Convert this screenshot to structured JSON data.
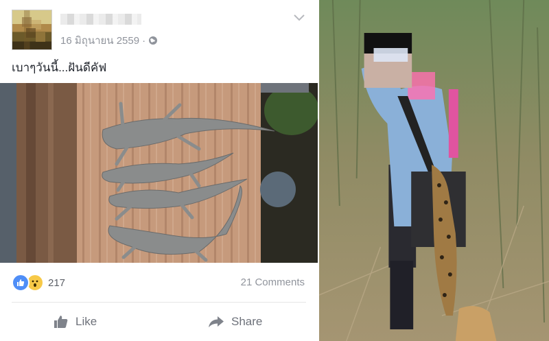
{
  "post": {
    "date": "16 มิถุนายน 2559",
    "separator": "·",
    "status_text": "เบาๆวันนี้...ฝันดีคัฟ",
    "reaction_count": "217",
    "comments_label": "21 Comments",
    "like_label": "Like",
    "share_label": "Share",
    "icons": {
      "audience": "globe-icon",
      "menu": "chevron-down-icon",
      "like_reaction": "thumbs-up-icon",
      "wow_reaction": "wow-face-icon",
      "like_action": "thumbs-up-icon",
      "share_action": "share-arrow-icon"
    }
  },
  "colors": {
    "meta_gray": "#90949c",
    "text_dark": "#1d2129",
    "like_blue": "#4f8ef7",
    "wow_yellow": "#f7c948",
    "action_gray": "#6d717a"
  }
}
